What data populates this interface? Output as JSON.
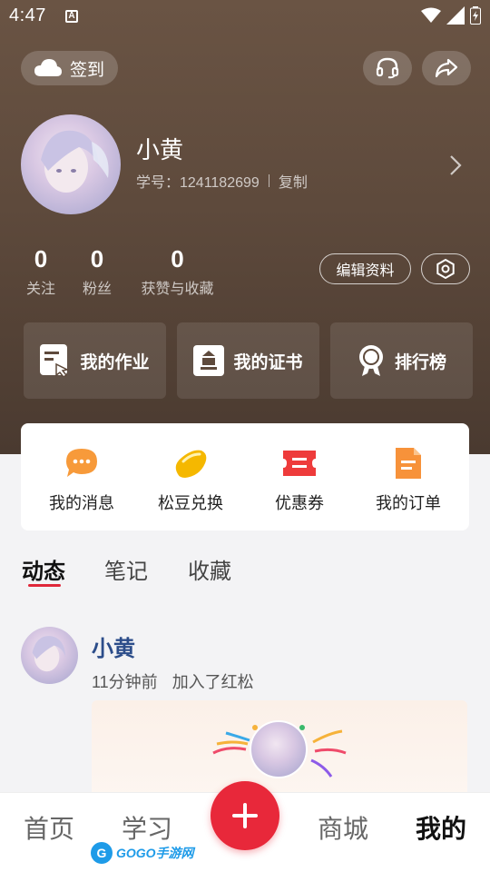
{
  "status_bar": {
    "time": "4:47",
    "indicator": "A"
  },
  "header": {
    "checkin_label": "签到",
    "headset_icon": "headset-icon",
    "share_icon": "share-icon"
  },
  "profile": {
    "name": "小黄",
    "uid_label": "学号：1241182699",
    "copy_label": "复制"
  },
  "stats": [
    {
      "value": "0",
      "label": "关注"
    },
    {
      "value": "0",
      "label": "粉丝"
    },
    {
      "value": "0",
      "label": "获赞与收藏"
    }
  ],
  "edit_profile_label": "编辑资料",
  "features": [
    {
      "label": "我的作业",
      "icon": "homework-icon"
    },
    {
      "label": "我的证书",
      "icon": "certificate-icon"
    },
    {
      "label": "排行榜",
      "icon": "ranking-icon"
    }
  ],
  "quick_actions": [
    {
      "label": "我的消息",
      "icon": "message-icon",
      "color": "#f79a3a"
    },
    {
      "label": "松豆兑换",
      "icon": "bean-icon",
      "color": "#f5b800"
    },
    {
      "label": "优惠券",
      "icon": "coupon-icon",
      "color": "#ee3b3b"
    },
    {
      "label": "我的订单",
      "icon": "order-icon",
      "color": "#f7923a"
    }
  ],
  "tabs": [
    {
      "label": "动态"
    },
    {
      "label": "笔记"
    },
    {
      "label": "收藏"
    }
  ],
  "feed": {
    "name": "小黄",
    "time": "11分钟前",
    "action": "加入了红松"
  },
  "bottom_nav": [
    {
      "label": "首页"
    },
    {
      "label": "学习"
    },
    {
      "label": "商城"
    },
    {
      "label": "我的"
    }
  ],
  "watermark": {
    "text": "GOGO手游网"
  },
  "colors": {
    "accent": "#e8283a",
    "header_bg": "#5e4a3c",
    "name_blue": "#2c4d8a"
  }
}
